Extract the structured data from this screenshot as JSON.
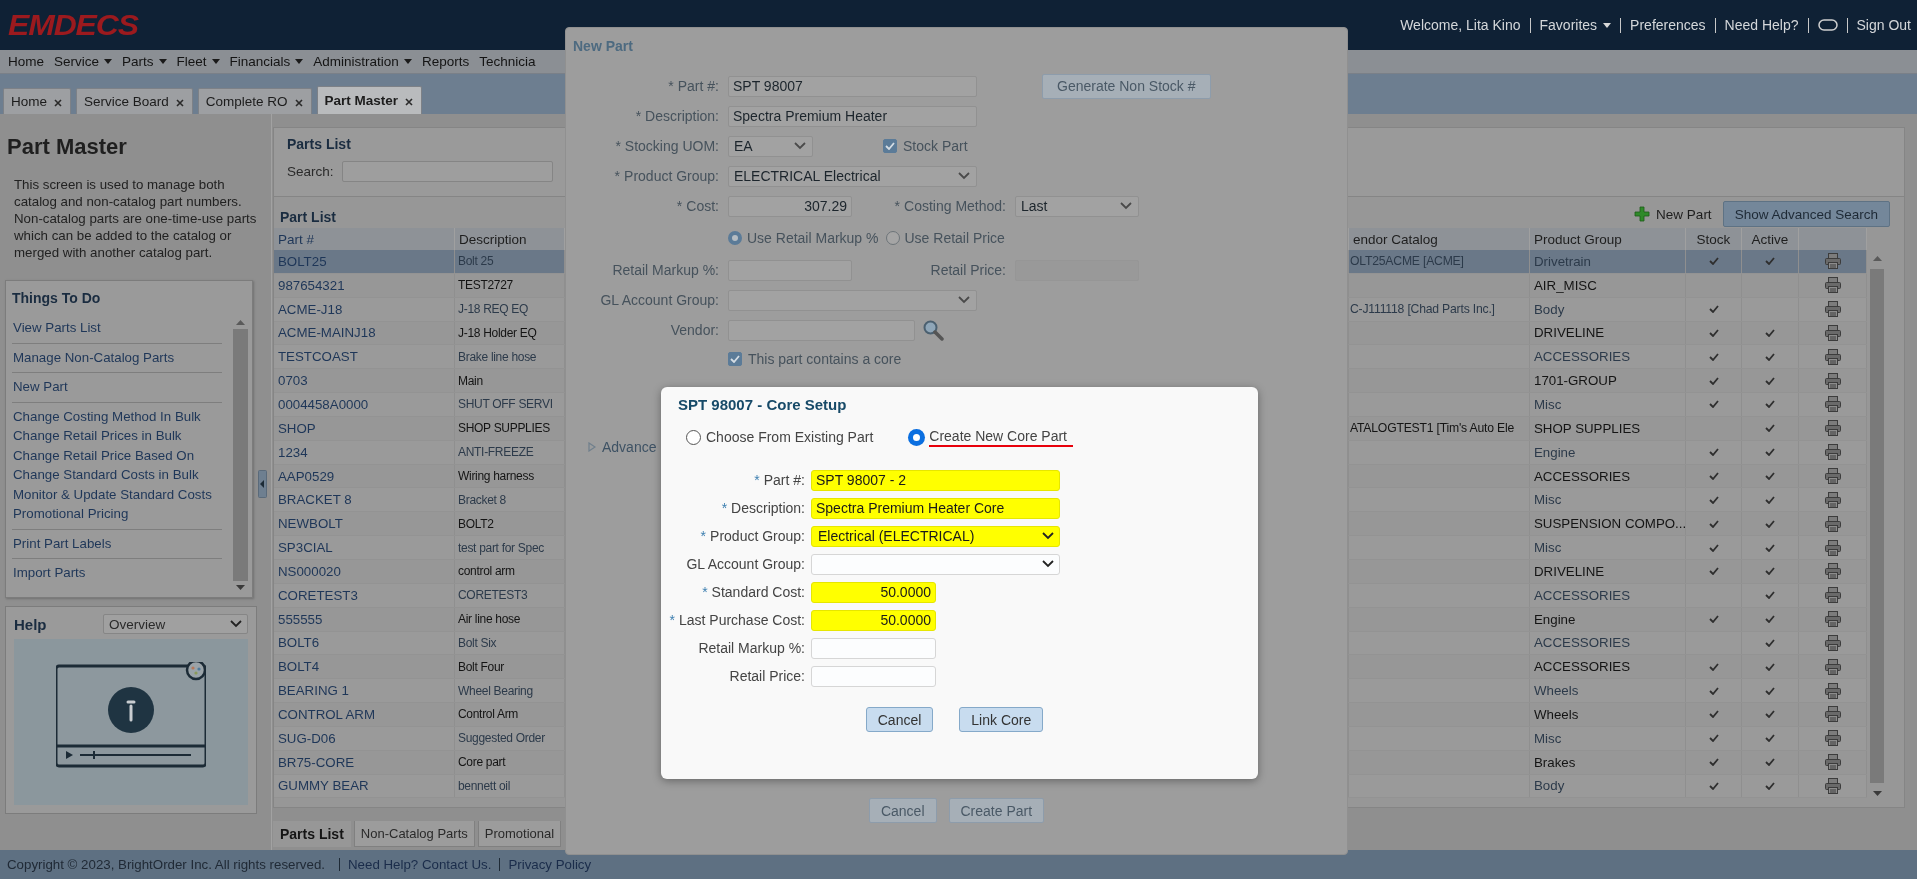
{
  "header": {
    "logo": "EMDECS",
    "items": [
      {
        "kind": "text",
        "label": "Welcome, Lita Kino"
      },
      {
        "kind": "menu",
        "label": "Favorites"
      },
      {
        "kind": "link",
        "label": "Preferences"
      },
      {
        "kind": "link",
        "label": "Need Help?"
      },
      {
        "kind": "toggle"
      },
      {
        "kind": "link",
        "label": "Sign Out"
      }
    ]
  },
  "nav": [
    {
      "label": "Home",
      "dropdown": false
    },
    {
      "label": "Service",
      "dropdown": true
    },
    {
      "label": "Parts",
      "dropdown": true
    },
    {
      "label": "Fleet",
      "dropdown": true
    },
    {
      "label": "Financials",
      "dropdown": true
    },
    {
      "label": "Administration",
      "dropdown": true
    },
    {
      "label": "Reports",
      "dropdown": false
    },
    {
      "label": "Technicia",
      "dropdown": false
    }
  ],
  "tabs": [
    {
      "label": "Home",
      "selected": false
    },
    {
      "label": "Service Board",
      "selected": false
    },
    {
      "label": "Complete RO",
      "selected": false
    },
    {
      "label": "Part Master",
      "selected": true
    }
  ],
  "sidebar": {
    "title": "Part Master",
    "intro": "This screen is used to manage both catalog and non-catalog part numbers. Non-catalog parts are one-time-use parts which can be added to the catalog or merged with another catalog part.",
    "todo": {
      "title": "Things To Do",
      "groups": [
        [
          "View Parts List"
        ],
        [
          "Manage Non-Catalog Parts"
        ],
        [
          "New Part"
        ],
        [
          "Change Costing Method In Bulk",
          "Change Retail Prices in Bulk",
          "Change Retail Price Based On",
          "Change Standard Costs in Bulk",
          "Monitor & Update Standard Costs",
          "Promotional Pricing"
        ],
        [
          "Print Part Labels"
        ],
        [
          "Import Parts"
        ]
      ]
    },
    "help": {
      "title": "Help",
      "topic": "Overview"
    }
  },
  "parts_list": {
    "title": "Parts List",
    "search": {
      "label": "Search:"
    }
  },
  "grid": {
    "title": "Part List",
    "new_part": "New Part",
    "advanced_search": "Show Advanced Search",
    "columns": [
      {
        "label": "Part #"
      },
      {
        "label": "Description"
      },
      {
        "label": "endor Catalog"
      },
      {
        "label": "Product Group"
      },
      {
        "label": "Stock"
      },
      {
        "label": "Active"
      }
    ],
    "rows": [
      {
        "part": "BOLT25",
        "description": "Bolt 25",
        "vendor": "OLT25ACME [ACME]",
        "group": "Drivetrain",
        "stock": true,
        "active": true,
        "selected": true
      },
      {
        "part": "987654321",
        "description": "TEST2727",
        "group": "AIR_MISC",
        "stock": false,
        "active": false,
        "selected": false
      },
      {
        "part": "ACME-J18",
        "description": "J-18 REQ EQ",
        "vendor": "C-J111118 [Chad Parts Inc.]",
        "group": "Body",
        "stock": true,
        "active": false,
        "selected": false
      },
      {
        "part": "ACME-MAINJ18",
        "description": "J-18 Holder EQ",
        "group": "DRIVELINE",
        "stock": true,
        "active": true,
        "selected": false
      },
      {
        "part": "TESTCOAST",
        "description": "Brake line hose",
        "group": "ACCESSORIES",
        "stock": true,
        "active": true,
        "selected": false
      },
      {
        "part": "0703",
        "description": "Main",
        "group": "1701-GROUP",
        "stock": true,
        "active": true,
        "selected": false
      },
      {
        "part": "0004458A0000",
        "description": "SHUT OFF SERVI",
        "group": "Misc",
        "stock": true,
        "active": true,
        "selected": false
      },
      {
        "part": "SHOP",
        "description": "SHOP SUPPLIES",
        "vendor": "ATALOGTEST1 [Tim's Auto Ele",
        "group": "SHOP SUPPLIES",
        "stock": false,
        "active": true,
        "selected": false
      },
      {
        "part": "1234",
        "description": "ANTI-FREEZE",
        "group": "Engine",
        "stock": true,
        "active": true,
        "selected": false
      },
      {
        "part": "AAP0529",
        "description": "Wiring harness",
        "group": "ACCESSORIES",
        "stock": true,
        "active": true,
        "selected": false
      },
      {
        "part": "BRACKET 8",
        "description": "Bracket 8",
        "group": "Misc",
        "stock": true,
        "active": true,
        "selected": false
      },
      {
        "part": "NEWBOLT",
        "description": "BOLT2",
        "group": "SUSPENSION COMPO...",
        "stock": true,
        "active": true,
        "selected": false
      },
      {
        "part": "SP3CIAL",
        "description": "test part for Spec",
        "group": "Misc",
        "stock": true,
        "active": true,
        "selected": false
      },
      {
        "part": "NS000020",
        "description": "control arm",
        "group": "DRIVELINE",
        "stock": true,
        "active": true,
        "selected": false
      },
      {
        "part": "CORETEST3",
        "description": "CORETEST3",
        "group": "ACCESSORIES",
        "stock": false,
        "active": true,
        "selected": false
      },
      {
        "part": "555555",
        "description": "Air line hose",
        "group": "Engine",
        "stock": true,
        "active": true,
        "selected": false
      },
      {
        "part": "BOLT6",
        "description": "Bolt Six",
        "group": "ACCESSORIES",
        "stock": false,
        "active": true,
        "selected": false
      },
      {
        "part": "BOLT4",
        "description": "Bolt Four",
        "group": "ACCESSORIES",
        "stock": true,
        "active": true,
        "selected": false
      },
      {
        "part": "BEARING 1",
        "description": "Wheel Bearing",
        "group": "Wheels",
        "stock": true,
        "active": true,
        "selected": false
      },
      {
        "part": "CONTROL ARM",
        "description": "Control Arm",
        "group": "Wheels",
        "stock": true,
        "active": true,
        "selected": false
      },
      {
        "part": "SUG-D06",
        "description": "Suggested Order",
        "group": "Misc",
        "stock": true,
        "active": true,
        "selected": false
      },
      {
        "part": "BR75-CORE",
        "description": "Core part",
        "group": "Brakes",
        "stock": true,
        "active": true,
        "selected": false
      },
      {
        "part": "GUMMY BEAR",
        "description": "bennett oil",
        "group": "Body",
        "stock": true,
        "active": true,
        "selected": false
      }
    ]
  },
  "bottom_tabs": [
    {
      "label": "Parts List",
      "selected": true
    },
    {
      "label": "Non-Catalog Parts",
      "selected": false
    },
    {
      "label": "Promotional",
      "selected": false
    }
  ],
  "footer": {
    "copyright": "Copyright © 2023, BrightOrder Inc. All rights reserved.",
    "links": [
      "Need Help? Contact Us.",
      "Privacy Policy"
    ]
  },
  "new_part": {
    "title": "New Part",
    "part_no": {
      "mark": "*",
      "label": "Part #:",
      "value": "SPT 98007"
    },
    "generate_button": "Generate Non Stock #",
    "description": {
      "mark": "*",
      "label": "Description:",
      "value": "Spectra Premium Heater"
    },
    "stocking_uom": {
      "mark": "*",
      "label": "Stocking UOM:",
      "value": "EA"
    },
    "stock_part": {
      "label": "Stock Part",
      "checked": true
    },
    "product_group": {
      "mark": "*",
      "label": "Product Group:",
      "value": "ELECTRICAL Electrical"
    },
    "cost": {
      "mark": "*",
      "label": "Cost:",
      "value": "307.29"
    },
    "costing_method": {
      "mark": "*",
      "label": "Costing Method:",
      "value": "Last"
    },
    "pricing_options": [
      {
        "label": "Use Retail Markup %",
        "selected": true
      },
      {
        "label": "Use Retail Price",
        "selected": false
      }
    ],
    "retail_markup": {
      "label": "Retail Markup %:"
    },
    "retail_price": {
      "label": "Retail Price:",
      "disabled": true
    },
    "gl_account_group": {
      "label": "GL Account Group:"
    },
    "vendor": {
      "label": "Vendor:"
    },
    "contains_core": {
      "label": "This part contains a core",
      "checked": true
    },
    "advanced": "Advance",
    "buttons": [
      "Cancel",
      "Create Part"
    ]
  },
  "core_setup": {
    "title": "SPT 98007 - Core Setup",
    "options": [
      {
        "label": "Choose From Existing Part",
        "selected": false,
        "underlined": false
      },
      {
        "label": "Create New Core Part",
        "selected": true,
        "underlined": true
      }
    ],
    "fields": [
      {
        "kind": "text",
        "mark": "*",
        "label": "Part #:",
        "value": "SPT 98007 - 2",
        "highlighted": true
      },
      {
        "kind": "text",
        "mark": "*",
        "label": "Description:",
        "value": "Spectra Premium Heater Core",
        "highlighted": true
      },
      {
        "kind": "select",
        "mark": "*",
        "label": "Product Group:",
        "value": "Electrical (ELECTRICAL)",
        "highlighted": true
      },
      {
        "kind": "select",
        "label": "GL Account Group:",
        "highlighted": false
      },
      {
        "kind": "number",
        "mark": "*",
        "label": "Standard Cost:",
        "value": "50.0000",
        "highlighted": true
      },
      {
        "kind": "number",
        "mark": "*",
        "label": "Last Purchase Cost:",
        "value": "50.0000",
        "highlighted": true
      },
      {
        "kind": "number",
        "label": "Retail Markup %:",
        "highlighted": false
      },
      {
        "kind": "number",
        "label": "Retail Price:",
        "highlighted": false
      }
    ],
    "buttons": [
      "Cancel",
      "Link Core"
    ]
  }
}
